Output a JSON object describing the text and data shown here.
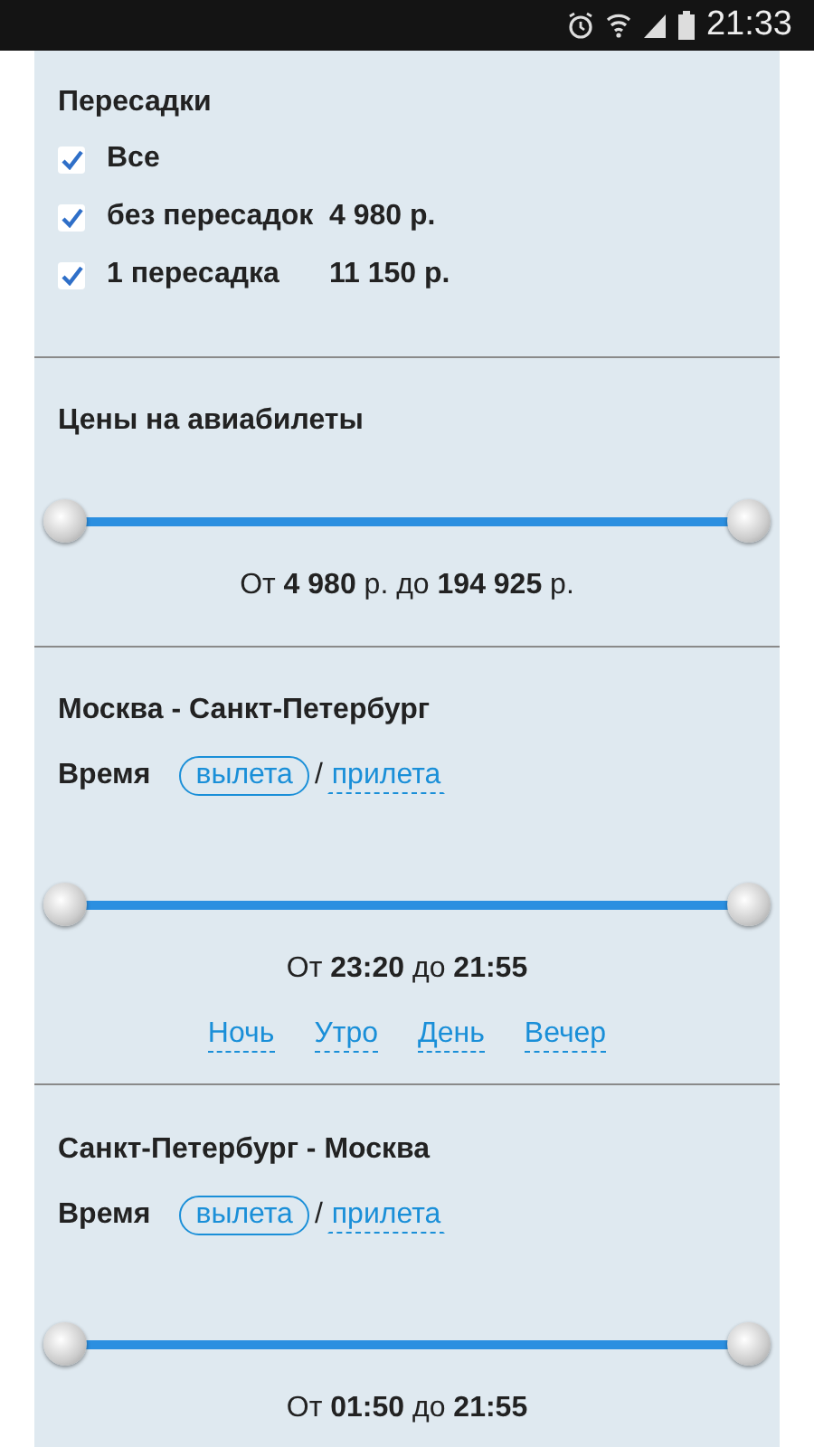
{
  "status_bar": {
    "time": "21:33"
  },
  "transfers": {
    "title": "Пересадки",
    "options": [
      {
        "label": "Все",
        "checked": true
      },
      {
        "label": "без пересадок",
        "price": "4 980 р.",
        "checked": true
      },
      {
        "label": "1 пересадка",
        "price": "11 150 р.",
        "checked": true
      }
    ]
  },
  "price_filter": {
    "title": "Цены на авиабилеты",
    "level": 1,
    "summary": "От **4 980** р. до **194 925** р."
  },
  "routes": [
    {
      "title": "Москва - Санкт-Петербург",
      "time_label": "Время",
      "separator": "/",
      "modes": [
        {
          "label": "вылета",
          "selected": true
        },
        {
          "label": "прилета",
          "selected": false
        }
      ],
      "level": 1,
      "summary": "От **23:20** до **21:55**",
      "periods": [
        "Ночь",
        "Утро",
        "День",
        "Вечер"
      ]
    },
    {
      "title": "Санкт-Петербург - Москва",
      "time_label": "Время",
      "separator": "/",
      "modes": [
        {
          "label": "вылета",
          "selected": true
        },
        {
          "label": "прилета",
          "selected": false
        }
      ],
      "level": 1,
      "summary": "От **01:50** до **21:55**"
    }
  ]
}
